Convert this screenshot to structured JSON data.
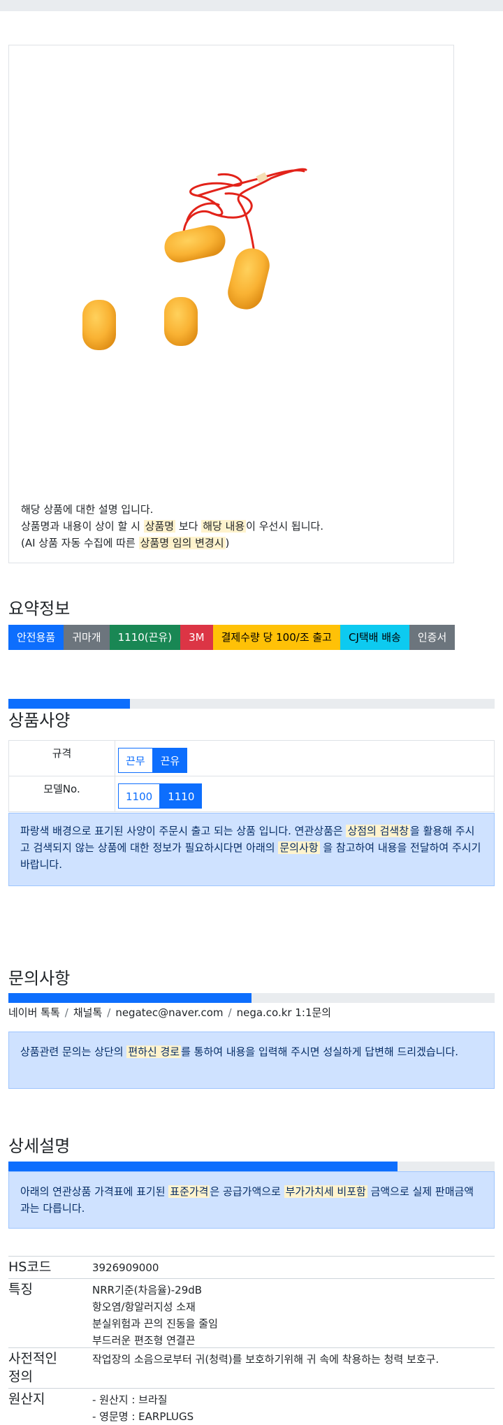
{
  "description": {
    "line1": "해당 상품에 대한 설명 입니다.",
    "line2_pre": "상품명과 내용이 상이 할 시 ",
    "line2_hl1": "상품명",
    "line2_mid": " 보다 ",
    "line2_hl2": "해당 내용",
    "line2_post": "이 우선시 됩니다.",
    "line3_pre": "(AI 상품 자동 수집에 따른 ",
    "line3_hl": "상품명 임의 변경시",
    "line3_post": ")"
  },
  "summary": {
    "title": "요약정보",
    "badges": [
      {
        "label": "안전용품",
        "color": "#0d6efd"
      },
      {
        "label": "귀마개",
        "color": "#6c757d"
      },
      {
        "label": "1110(끈유)",
        "color": "#198754"
      },
      {
        "label": "3M",
        "color": "#dc3545"
      },
      {
        "label": "결제수량 당 100/조 출고",
        "color": "#ffc107"
      },
      {
        "label": "CJ택배 배송",
        "color": "#0dcaf0"
      },
      {
        "label": "인증서",
        "color": "#6c757d"
      }
    ]
  },
  "spec": {
    "title": "상품사양",
    "progress": 0.25,
    "rows": [
      {
        "label": "규격",
        "options": [
          {
            "label": "끈무",
            "selected": false
          },
          {
            "label": "끈유",
            "selected": true
          }
        ]
      },
      {
        "label": "모델No.",
        "options": [
          {
            "label": "1100",
            "selected": false
          },
          {
            "label": "1110",
            "selected": true
          }
        ]
      }
    ],
    "notice_pre": "파랑색 배경으로 표기된 사양이 주문시 출고 되는 상품 입니다. 연관상품은 ",
    "notice_hl1": "상점의 검색창",
    "notice_mid": "을 활용해 주시고 검색되지 않는 상품에 대한 정보가 필요하시다면 아래의 ",
    "notice_hl2": "문의사항",
    "notice_post": " 을 참고하여 내용을 전달하여 주시기 바랍니다."
  },
  "inquiry": {
    "title": "문의사항",
    "progress": 0.5,
    "links": [
      "네이버 톡톡",
      "채널톡",
      "negatec@naver.com",
      "nega.co.kr 1:1문의"
    ],
    "sep": "/",
    "notice_pre": "상품관련 문의는 상단의 ",
    "notice_hl": "편하신 경로",
    "notice_post": "를 통하여 내용을 입력해 주시면 성실하게 답변해 드리겠습니다."
  },
  "detail": {
    "title": "상세설명",
    "progress": 0.8,
    "notice_pre": "아래의 연관상품 가격표에 표기된 ",
    "notice_hl1": "표준가격",
    "notice_mid": "은 공급가액으로 ",
    "notice_hl2": "부가가치세 비포함",
    "notice_post": " 금액으로 실제 판매금액과는 다릅니다.",
    "rows": [
      {
        "key": "HS코드",
        "lines": [
          "3926909000"
        ]
      },
      {
        "key": "특징",
        "lines": [
          "NRR기준(차음율)-29dB",
          "항오염/항알러지성 소재",
          "분실위험과 끈의 진동을 줄임",
          "부드러운 편조형 연결끈"
        ]
      },
      {
        "key_l1": "사전적인",
        "key_l2": "정의",
        "lines": [
          "작업장의 소음으로부터 귀(청력)를 보호하기위해 귀 속에 착용하는 청력 보호구."
        ]
      },
      {
        "key": "원산지",
        "lines": [
          "- 원산지 : 브라질",
          "- 영문명 : EARPLUGS"
        ]
      }
    ]
  }
}
